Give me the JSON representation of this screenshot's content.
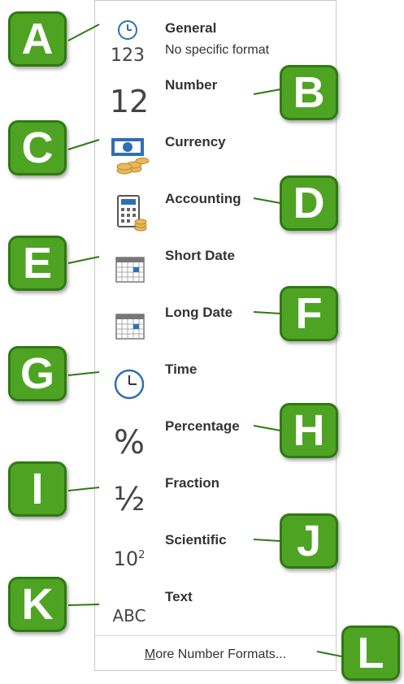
{
  "menu": {
    "items": [
      {
        "label": "General",
        "sub": "No specific format",
        "icon": "general-clock-123-icon",
        "glyph": "123"
      },
      {
        "label": "Number",
        "icon": "number-icon",
        "glyph": "12"
      },
      {
        "label": "Currency",
        "icon": "currency-icon"
      },
      {
        "label": "Accounting",
        "icon": "accounting-calculator-icon"
      },
      {
        "label": "Short Date",
        "icon": "calendar-icon"
      },
      {
        "label": "Long Date",
        "icon": "calendar-icon"
      },
      {
        "label": "Time",
        "icon": "clock-icon"
      },
      {
        "label": "Percentage",
        "icon": "percent-icon",
        "glyph": "%"
      },
      {
        "label": "Fraction",
        "icon": "fraction-icon",
        "glyph": "½"
      },
      {
        "label": "Scientific",
        "icon": "scientific-icon",
        "glyph": "10",
        "sup": "2"
      },
      {
        "label": "Text",
        "icon": "text-icon",
        "glyph": "ABC"
      }
    ],
    "more": {
      "u": "M",
      "rest": "ore Number Formats..."
    }
  },
  "callouts": [
    "A",
    "B",
    "C",
    "D",
    "E",
    "F",
    "G",
    "H",
    "I",
    "J",
    "K",
    "L"
  ],
  "colors": {
    "callout_fill": "#4ea422",
    "callout_border": "#2f7a12",
    "icon_blue": "#2e6fb4",
    "coin": "#e8b85a"
  }
}
